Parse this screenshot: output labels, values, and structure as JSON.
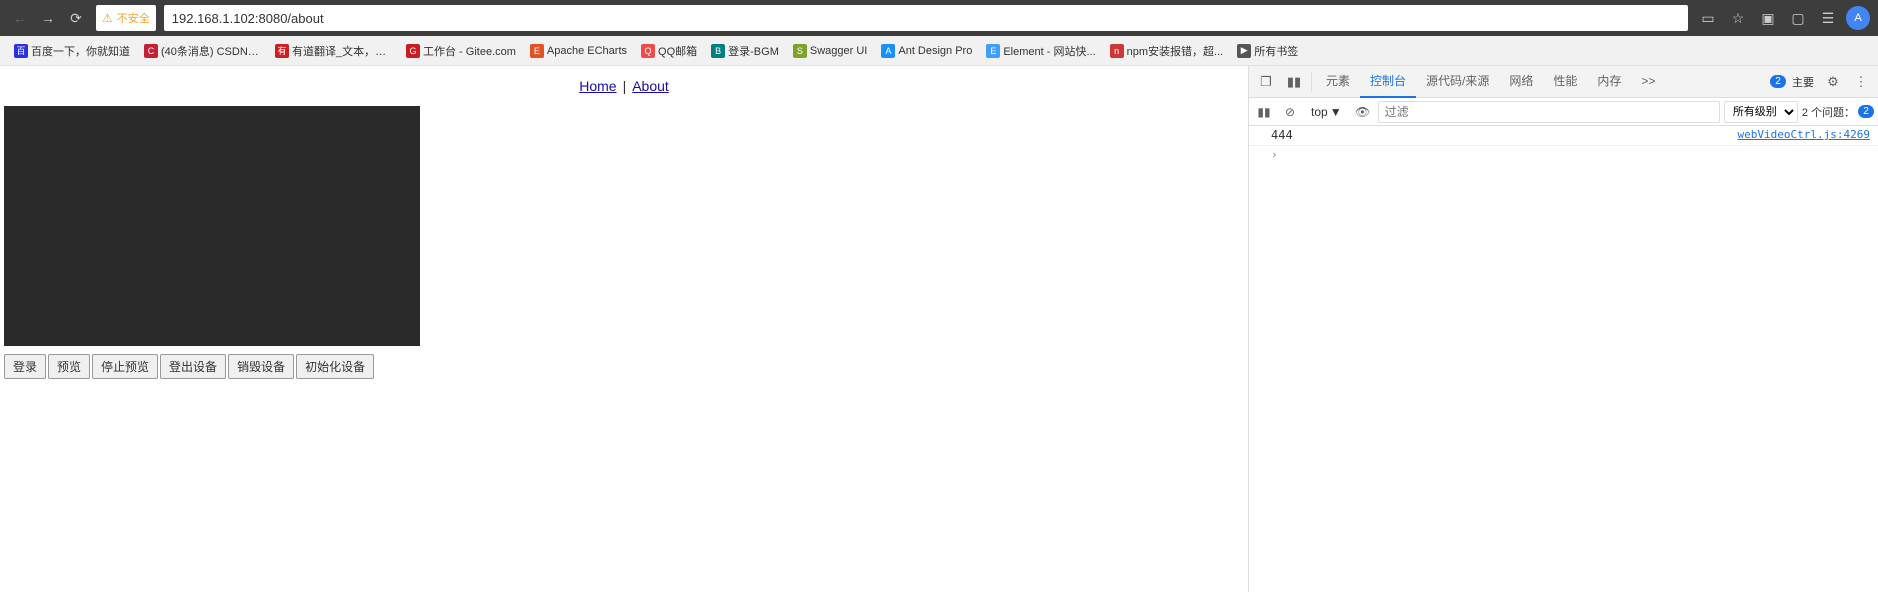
{
  "browser": {
    "back_disabled": true,
    "forward_disabled": false,
    "url": "192.168.1.102:8080/about",
    "security_label": "不安全",
    "profile_letter": "A"
  },
  "bookmarks": [
    {
      "id": "baidu",
      "label": "百度一下，你就知道",
      "icon": "百",
      "color": "bm-baidu"
    },
    {
      "id": "csdn",
      "label": "(40条消息) CSDN -...",
      "icon": "C",
      "color": "bm-csdn"
    },
    {
      "id": "youdao",
      "label": "有道翻译_文本，文...",
      "icon": "有",
      "color": "bm-youdao"
    },
    {
      "id": "gitee",
      "label": "工作台 - Gitee.com",
      "icon": "G",
      "color": "bm-gitee"
    },
    {
      "id": "echarts",
      "label": "Apache ECharts",
      "icon": "E",
      "color": "bm-echarts"
    },
    {
      "id": "qq",
      "label": "QQ邮箱",
      "icon": "Q",
      "color": "bm-qq"
    },
    {
      "id": "bgm",
      "label": "登录-BGM",
      "icon": "B",
      "color": "bm-bgm"
    },
    {
      "id": "swagger",
      "label": "Swagger UI",
      "icon": "S",
      "color": "bm-swagger"
    },
    {
      "id": "ant",
      "label": "Ant Design Pro",
      "icon": "A",
      "color": "bm-ant"
    },
    {
      "id": "element",
      "label": "Element - 网站快...",
      "icon": "E",
      "color": "bm-element"
    },
    {
      "id": "npm",
      "label": "npm安装报错，超...",
      "icon": "n",
      "color": "bm-npm"
    },
    {
      "id": "all",
      "label": "所有书签",
      "icon": "▶",
      "color": "bm-all"
    }
  ],
  "page": {
    "nav_home": "Home",
    "nav_separator": "|",
    "nav_about": "About",
    "buttons": [
      {
        "id": "login",
        "label": "登录"
      },
      {
        "id": "preview",
        "label": "预览"
      },
      {
        "id": "stop_preview",
        "label": "停止预览"
      },
      {
        "id": "logout",
        "label": "登出设备"
      },
      {
        "id": "destroy",
        "label": "销毁设备"
      },
      {
        "id": "init",
        "label": "初始化设备"
      }
    ]
  },
  "devtools": {
    "tabs": [
      {
        "id": "elements",
        "label": "元素",
        "active": false
      },
      {
        "id": "console",
        "label": "控制台",
        "active": true
      },
      {
        "id": "sources",
        "label": "源代码/来源",
        "active": false
      },
      {
        "id": "network",
        "label": "网络",
        "active": false
      },
      {
        "id": "performance",
        "label": "性能",
        "active": false
      },
      {
        "id": "memory",
        "label": "内存",
        "active": false
      },
      {
        "id": "more",
        "label": ">>",
        "active": false
      }
    ],
    "toolbar2": {
      "context": "top",
      "filter_placeholder": "过滤",
      "level_select": "所有级别",
      "issues_count": "2 个问题：",
      "issues_badge": "2"
    },
    "console_entries": [
      {
        "id": 1,
        "value": "444",
        "file": "webVideoCtrl.js:4269",
        "type": "log",
        "expandable": false
      }
    ],
    "expand_row": {
      "symbol": "›"
    },
    "badge_count": "2",
    "main_theme": "主要",
    "settings_icon": "⚙",
    "more_icon": "⋮"
  }
}
